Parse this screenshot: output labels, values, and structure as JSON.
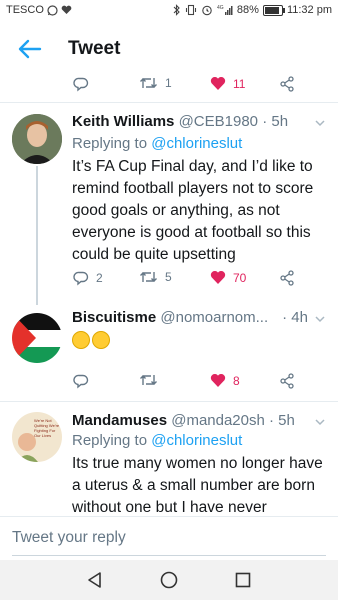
{
  "status_bar": {
    "carrier": "TESCO",
    "battery": "88%",
    "battery_level": 0.88,
    "time": "11:32 pm"
  },
  "header": {
    "title": "Tweet"
  },
  "prev_tweet_actions": {
    "reply_count": "",
    "retweet_count": "1",
    "like_count": "11"
  },
  "tweets": [
    {
      "name": "Keith Williams",
      "handle": "@CEB1980",
      "time": "· 5h",
      "replying_prefix": "Replying to ",
      "replying_to": "@chlorineslut",
      "text": "It’s FA Cup Final day, and I’d like to remind football players not to score good goals or anything, as not everyone is good at football so this could be quite upsetting",
      "reply_count": "2",
      "retweet_count": "5",
      "like_count": "70"
    },
    {
      "name": "Biscuitisme",
      "handle": "@nomoarnom...",
      "time": "· 4h",
      "emoji_label": "🤣🤣",
      "reply_count": "",
      "retweet_count": "",
      "like_count": "8"
    },
    {
      "name": "Mandamuses",
      "handle": "@manda20sh",
      "time": "· 5h",
      "replying_prefix": "Replying to ",
      "replying_to": "@chlorineslut",
      "text": "Its true many women no longer have a uterus & a small number are born without one but I have never",
      "avatar_text": "We're Not Quitting We're Fighting For Our Lives"
    }
  ],
  "composer": {
    "placeholder": "Tweet your reply"
  },
  "colors": {
    "accent": "#1da1f2",
    "like": "#e0245e",
    "muted": "#657786"
  }
}
